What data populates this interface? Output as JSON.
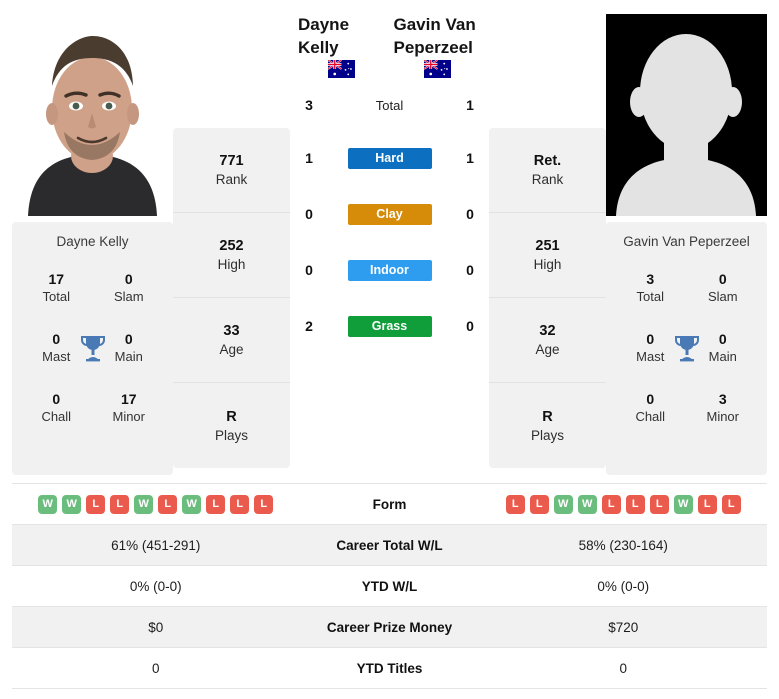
{
  "colors": {
    "hard": "#0c6fc0",
    "clay": "#d68c08",
    "indoor": "#2e9df0",
    "grass": "#0f9e3a",
    "win": "#6bbd7e",
    "loss": "#eb5b4d",
    "trophy": "#4a7ab5",
    "card_bg": "#f1f1f1"
  },
  "left": {
    "name": "Dayne Kelly",
    "photo_alt": "player-photo-dayne-kelly",
    "flag": "AU",
    "card_name": "Dayne Kelly",
    "titles": [
      {
        "value": "17",
        "label": "Total"
      },
      {
        "value": "0",
        "label": "Slam"
      },
      {
        "value": "0",
        "label": "Mast"
      },
      {
        "value": "0",
        "label": "Main"
      },
      {
        "value": "0",
        "label": "Chall"
      },
      {
        "value": "17",
        "label": "Minor"
      }
    ],
    "strips": [
      {
        "value": "771",
        "label": "Rank"
      },
      {
        "value": "252",
        "label": "High"
      },
      {
        "value": "33",
        "label": "Age"
      },
      {
        "value": "R",
        "label": "Plays"
      }
    ],
    "form": [
      "W",
      "W",
      "L",
      "L",
      "W",
      "L",
      "W",
      "L",
      "L",
      "L"
    ],
    "career_wl": "61% (451-291)",
    "ytd_wl": "0% (0-0)",
    "prize": "$0",
    "ytd_titles": "0"
  },
  "right": {
    "name": "Gavin Van Peperzeel",
    "photo_alt": "player-photo-placeholder",
    "flag": "AU",
    "card_name": "Gavin Van Peperzeel",
    "titles": [
      {
        "value": "3",
        "label": "Total"
      },
      {
        "value": "0",
        "label": "Slam"
      },
      {
        "value": "0",
        "label": "Mast"
      },
      {
        "value": "0",
        "label": "Main"
      },
      {
        "value": "0",
        "label": "Chall"
      },
      {
        "value": "3",
        "label": "Minor"
      }
    ],
    "strips": [
      {
        "value": "Ret.",
        "label": "Rank"
      },
      {
        "value": "251",
        "label": "High"
      },
      {
        "value": "32",
        "label": "Age"
      },
      {
        "value": "R",
        "label": "Plays"
      }
    ],
    "form": [
      "L",
      "L",
      "W",
      "W",
      "L",
      "L",
      "L",
      "W",
      "L",
      "L"
    ],
    "career_wl": "58% (230-164)",
    "ytd_wl": "0% (0-0)",
    "prize": "$720",
    "ytd_titles": "0"
  },
  "surfaces": [
    {
      "label": "Total",
      "left": "3",
      "right": "1",
      "bar": false
    },
    {
      "label": "Hard",
      "left": "1",
      "right": "1",
      "bar": true,
      "color": "#0c6fc0"
    },
    {
      "label": "Clay",
      "left": "0",
      "right": "0",
      "bar": true,
      "color": "#d68c08"
    },
    {
      "label": "Indoor",
      "left": "0",
      "right": "0",
      "bar": true,
      "color": "#2e9df0"
    },
    {
      "label": "Grass",
      "left": "2",
      "right": "0",
      "bar": true,
      "color": "#0f9e3a"
    }
  ],
  "table": {
    "form_label": "Career Total W/L",
    "rows": [
      {
        "label": "Form",
        "type": "form"
      },
      {
        "label": "Career Total W/L",
        "left": "61% (451-291)",
        "right": "58% (230-164)"
      },
      {
        "label": "YTD W/L",
        "left": "0% (0-0)",
        "right": "0% (0-0)"
      },
      {
        "label": "Career Prize Money",
        "left": "$0",
        "right": "$720"
      },
      {
        "label": "YTD Titles",
        "left": "0",
        "right": "0"
      }
    ]
  }
}
